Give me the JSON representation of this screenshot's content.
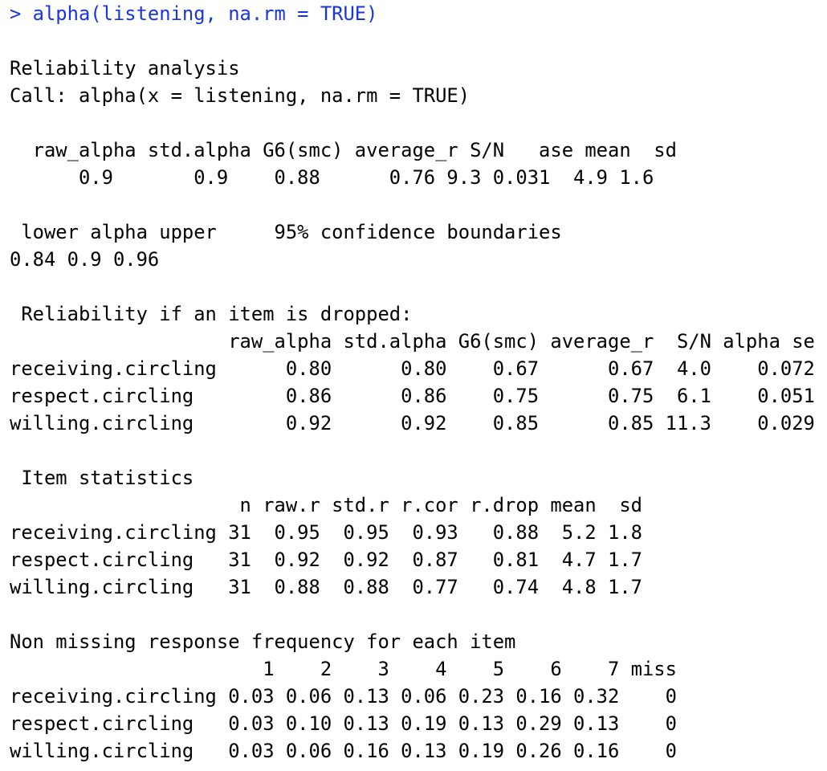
{
  "command": {
    "prompt": ">",
    "text": "alpha(listening, na.rm = TRUE)",
    "color": "#1a35e0"
  },
  "output": {
    "title": "Reliability analysis",
    "call": "Call: alpha(x = listening, na.rm = TRUE)",
    "summary": {
      "header": "  raw_alpha std.alpha G6(smc) average_r S/N   ase mean  sd",
      "values": "      0.9       0.9    0.88      0.76 9.3 0.031  4.9 1.6"
    },
    "confidence": {
      "header": " lower alpha upper     95% confidence boundaries",
      "values": "0.84 0.9 0.96"
    },
    "dropped": {
      "title": " Reliability if an item is dropped:",
      "header": "                   raw_alpha std.alpha G6(smc) average_r  S/N alpha se",
      "rows": [
        "receiving.circling      0.80      0.80    0.67      0.67  4.0    0.072",
        "respect.circling        0.86      0.86    0.75      0.75  6.1    0.051",
        "willing.circling        0.92      0.92    0.85      0.85 11.3    0.029"
      ]
    },
    "item_stats": {
      "title": " Item statistics",
      "header": "                    n raw.r std.r r.cor r.drop mean  sd",
      "rows": [
        "receiving.circling 31  0.95  0.95  0.93   0.88  5.2 1.8",
        "respect.circling   31  0.92  0.92  0.87   0.81  4.7 1.7",
        "willing.circling   31  0.88  0.88  0.77   0.74  4.8 1.7"
      ]
    },
    "freq": {
      "title": "Non missing response frequency for each item",
      "header": "                      1    2    3    4    5    6    7 miss",
      "rows": [
        "receiving.circling 0.03 0.06 0.13 0.06 0.23 0.16 0.32    0",
        "respect.circling   0.03 0.10 0.13 0.19 0.13 0.29 0.13    0",
        "willing.circling   0.03 0.06 0.16 0.13 0.19 0.26 0.16    0"
      ]
    }
  }
}
